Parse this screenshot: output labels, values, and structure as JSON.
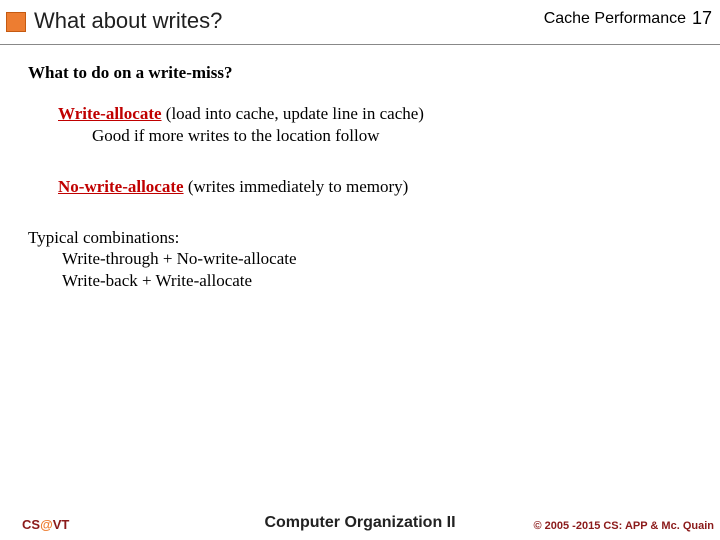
{
  "header": {
    "title": "What about writes?",
    "topic": "Cache Performance",
    "page": "17"
  },
  "content": {
    "question": "What to do on a write-miss?",
    "writeAllocate": {
      "term": "Write-allocate",
      "desc": " (load into cache, update line in cache)",
      "note": "Good if more writes to the location follow"
    },
    "noWriteAllocate": {
      "term": "No-write-allocate",
      "desc": " (writes immediately to memory)"
    },
    "typical": {
      "heading": "Typical combinations:",
      "combo1": "Write-through + No-write-allocate",
      "combo2": "Write-back + Write-allocate"
    }
  },
  "footer": {
    "left": {
      "cs": "CS",
      "at": "@",
      "vt": "VT"
    },
    "center": "Computer Organization II",
    "right": "© 2005 -2015 CS: APP & Mc. Quain"
  }
}
